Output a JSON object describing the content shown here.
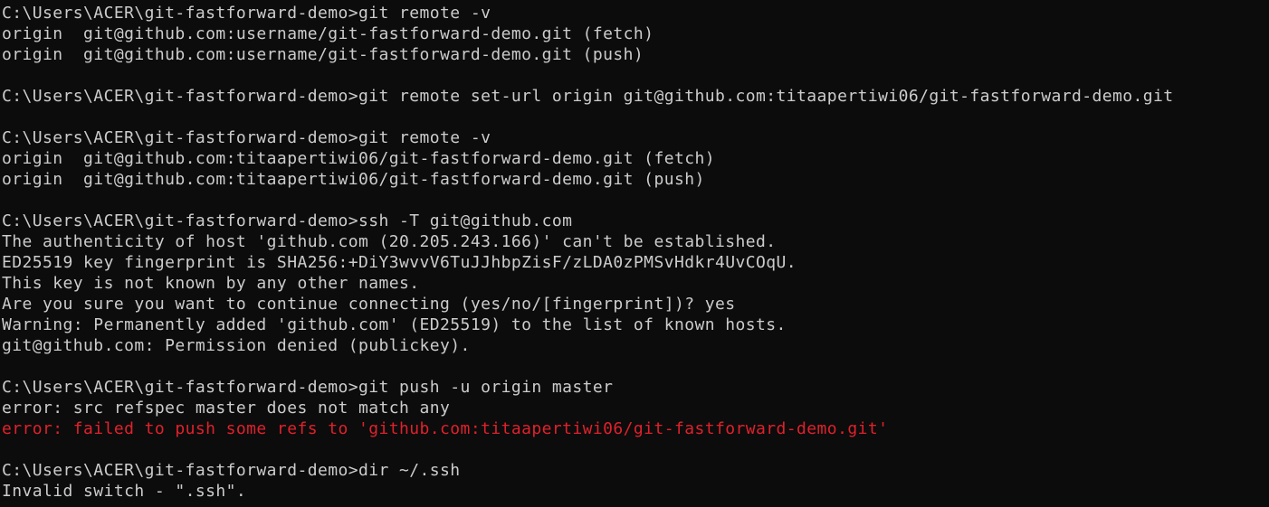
{
  "terminal": {
    "colors": {
      "background": "#0c0c0c",
      "foreground": "#cccccc",
      "error": "#e0212c"
    },
    "lines": [
      {
        "text": "C:\\Users\\ACER\\git-fastforward-demo>git remote -v",
        "kind": "prompt"
      },
      {
        "text": "origin  git@github.com:username/git-fastforward-demo.git (fetch)",
        "kind": "output"
      },
      {
        "text": "origin  git@github.com:username/git-fastforward-demo.git (push)",
        "kind": "output"
      },
      {
        "text": "",
        "kind": "blank"
      },
      {
        "text": "C:\\Users\\ACER\\git-fastforward-demo>git remote set-url origin git@github.com:titaapertiwi06/git-fastforward-demo.git",
        "kind": "prompt"
      },
      {
        "text": "",
        "kind": "blank"
      },
      {
        "text": "C:\\Users\\ACER\\git-fastforward-demo>git remote -v",
        "kind": "prompt"
      },
      {
        "text": "origin  git@github.com:titaapertiwi06/git-fastforward-demo.git (fetch)",
        "kind": "output"
      },
      {
        "text": "origin  git@github.com:titaapertiwi06/git-fastforward-demo.git (push)",
        "kind": "output"
      },
      {
        "text": "",
        "kind": "blank"
      },
      {
        "text": "C:\\Users\\ACER\\git-fastforward-demo>ssh -T git@github.com",
        "kind": "prompt"
      },
      {
        "text": "The authenticity of host 'github.com (20.205.243.166)' can't be established.",
        "kind": "output"
      },
      {
        "text": "ED25519 key fingerprint is SHA256:+DiY3wvvV6TuJJhbpZisF/zLDA0zPMSvHdkr4UvCOqU.",
        "kind": "output"
      },
      {
        "text": "This key is not known by any other names.",
        "kind": "output"
      },
      {
        "text": "Are you sure you want to continue connecting (yes/no/[fingerprint])? yes",
        "kind": "output"
      },
      {
        "text": "Warning: Permanently added 'github.com' (ED25519) to the list of known hosts.",
        "kind": "output"
      },
      {
        "text": "git@github.com: Permission denied (publickey).",
        "kind": "output"
      },
      {
        "text": "",
        "kind": "blank"
      },
      {
        "text": "C:\\Users\\ACER\\git-fastforward-demo>git push -u origin master",
        "kind": "prompt"
      },
      {
        "text": "error: src refspec master does not match any",
        "kind": "output"
      },
      {
        "text": "error: failed to push some refs to 'github.com:titaapertiwi06/git-fastforward-demo.git'",
        "kind": "error"
      },
      {
        "text": "",
        "kind": "blank"
      },
      {
        "text": "C:\\Users\\ACER\\git-fastforward-demo>dir ~/.ssh",
        "kind": "prompt"
      },
      {
        "text": "Invalid switch - \".ssh\".",
        "kind": "output"
      }
    ]
  }
}
